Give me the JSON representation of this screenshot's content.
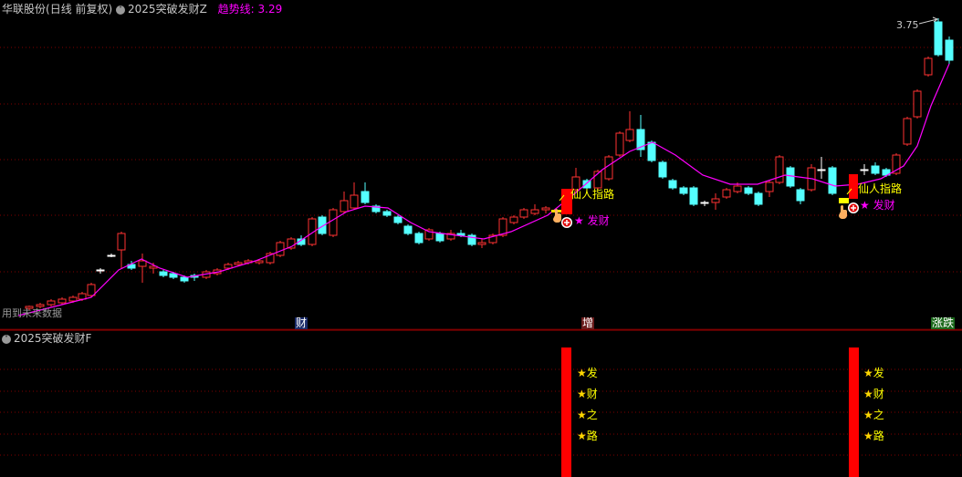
{
  "header": {
    "stock": "华联股份",
    "period": "(日线 前复权)",
    "indicator_main": "2025突破发财Z",
    "trend_label": "趋势线:",
    "trend_value": "3.29"
  },
  "sub_header": {
    "indicator_sub": "2025突破发财F"
  },
  "price_label": "3.75",
  "footer_left_text": "用到未来数据",
  "axis_markers": {
    "m1": "财",
    "m2": "增",
    "m3": "涨跌"
  },
  "signals": [
    {
      "name": "仙人指路",
      "fa": "发财"
    },
    {
      "name": "仙人指路",
      "fa": "发财"
    }
  ],
  "sub_signals": [
    {
      "lines": [
        "发",
        "财",
        "之",
        "路"
      ]
    },
    {
      "lines": [
        "发",
        "财",
        "之",
        "路"
      ]
    }
  ],
  "colors": {
    "up": "#ff3232",
    "down": "#54ffff",
    "trend": "#ff00ff",
    "signal_bar": "#ff0000",
    "grid": "#800000",
    "label_yellow": "#ffff00",
    "label_magenta": "#ff00ff",
    "star": "#ffd700",
    "white_wick": "#ffffff"
  },
  "icons": [
    "circle-arrow-icon",
    "hand-pointer-icon",
    "plus-circle-icon",
    "star-icon",
    "arrow-icon"
  ]
}
